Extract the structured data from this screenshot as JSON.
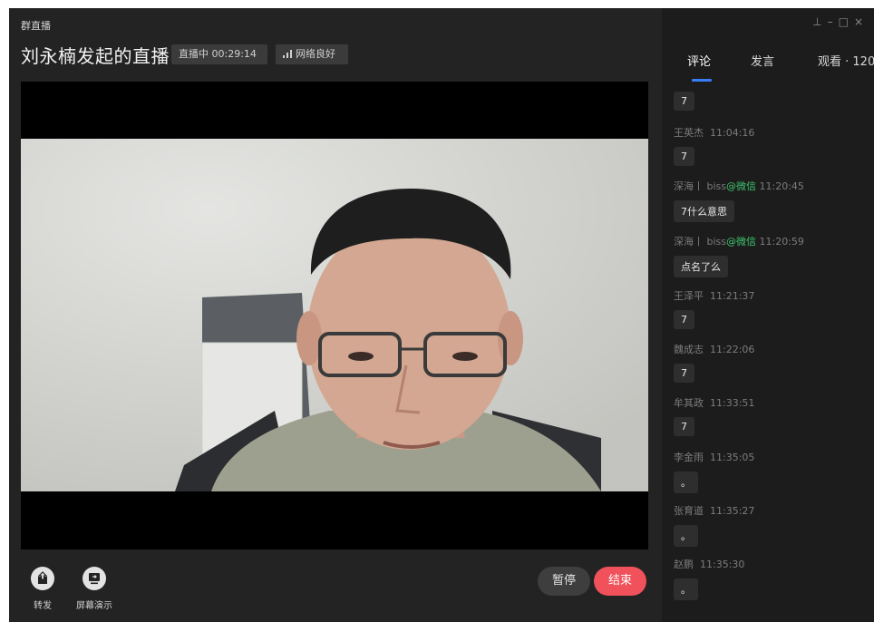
{
  "app": {
    "title": "群直播"
  },
  "live": {
    "title": "刘永楠发起的直播",
    "status_label": "直播中 00:29:14",
    "network_label": "网络良好"
  },
  "tools": {
    "share_label": "转发",
    "screen_label": "屏幕演示"
  },
  "buttons": {
    "pause_label": "暂停",
    "end_label": "结束"
  },
  "window_controls": {
    "pin": "⊥",
    "minimize": "–",
    "maximize": "□",
    "close": "×"
  },
  "tabs": {
    "comments": "评论",
    "speak": "发言",
    "watch": "观看 · 120"
  },
  "comments": [
    {
      "text": "7"
    },
    {
      "user": "王英杰",
      "time": "11:04:16",
      "text": "7"
    },
    {
      "user": "深海丨 biss",
      "source": "@微信",
      "time": "11:20:45",
      "text": "7什么意思"
    },
    {
      "user": "深海丨 biss",
      "source": "@微信",
      "time": "11:20:59",
      "text": "点名了么"
    },
    {
      "user": "王泽平",
      "time": "11:21:37",
      "text": "7"
    },
    {
      "user": "魏成志",
      "time": "11:22:06",
      "text": "7"
    },
    {
      "user": "牟其政",
      "time": "11:33:51",
      "text": "7"
    },
    {
      "user": "李金雨",
      "time": "11:35:05",
      "text": "。"
    },
    {
      "user": "张育道",
      "time": "11:35:27",
      "text": "。"
    },
    {
      "user": "赵鹏",
      "time": "11:35:30",
      "text": "。"
    }
  ],
  "colors": {
    "accent_blue": "#3a7cf5",
    "end_red": "#f0515a",
    "wechat_green": "#3ec46d"
  }
}
